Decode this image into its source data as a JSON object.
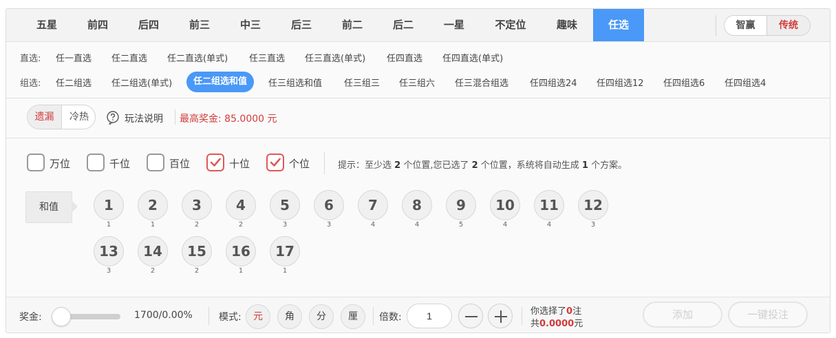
{
  "tabs": [
    "五星",
    "前四",
    "后四",
    "前三",
    "中三",
    "后三",
    "前二",
    "后二",
    "一星",
    "不定位",
    "趣味",
    "任选"
  ],
  "active_tab": "任选",
  "mode_switch": {
    "left": "智赢",
    "right": "传统",
    "active": "传统"
  },
  "subplays": {
    "direct": {
      "label": "直选:",
      "items": [
        "任一直选",
        "任二直选",
        "任二直选(单式)",
        "任三直选",
        "任三直选(单式)",
        "任四直选",
        "任四直选(单式)"
      ]
    },
    "group": {
      "label": "组选:",
      "items": [
        "任二组选",
        "任二组选(单式)",
        "任二组选和值",
        "任三组选和值",
        "任三组三",
        "任三组六",
        "任三混合组选",
        "任四组选24",
        "任四组选12",
        "任四组选6",
        "任四组选4"
      ],
      "active": "任二组选和值"
    }
  },
  "info": {
    "miss_switch": {
      "left": "遗漏",
      "right": "冷热",
      "active": "遗漏"
    },
    "help_label": "玩法说明",
    "max_prize": "最高奖金: 85.0000 元"
  },
  "positions": [
    {
      "label": "万位",
      "checked": false
    },
    {
      "label": "千位",
      "checked": false
    },
    {
      "label": "百位",
      "checked": false
    },
    {
      "label": "十位",
      "checked": true
    },
    {
      "label": "个位",
      "checked": true
    }
  ],
  "hint": {
    "t1": "提示：至少选 ",
    "n1": "2",
    "t2": " 个位置,您已选了 ",
    "n2": "2",
    "t3": " 个位置，系统将自动生成 ",
    "n3": "1",
    "t4": " 个方案。"
  },
  "sum_label": "和值",
  "balls": [
    {
      "num": "1",
      "miss": "1"
    },
    {
      "num": "2",
      "miss": "1"
    },
    {
      "num": "3",
      "miss": "2"
    },
    {
      "num": "4",
      "miss": "2"
    },
    {
      "num": "5",
      "miss": "3"
    },
    {
      "num": "6",
      "miss": "3"
    },
    {
      "num": "7",
      "miss": "4"
    },
    {
      "num": "8",
      "miss": "4"
    },
    {
      "num": "9",
      "miss": "5"
    },
    {
      "num": "10",
      "miss": "4"
    },
    {
      "num": "11",
      "miss": "4"
    },
    {
      "num": "12",
      "miss": "3"
    },
    {
      "num": "13",
      "miss": "3"
    },
    {
      "num": "14",
      "miss": "2"
    },
    {
      "num": "15",
      "miss": "2"
    },
    {
      "num": "16",
      "miss": "1"
    },
    {
      "num": "17",
      "miss": "1"
    }
  ],
  "footer": {
    "prize_label": "奖金:",
    "prize_value": "1700/0.00%",
    "slider_level": 0,
    "mode_label": "模式:",
    "units": [
      "元",
      "角",
      "分",
      "厘"
    ],
    "active_unit": "元",
    "multiple_label": "倍数:",
    "multiple_value": "1",
    "summary": {
      "t1": "你选择了",
      "count": "0",
      "t2": "注",
      "t3": "共",
      "amount": "0.0000",
      "t4": "元"
    },
    "add_label": "添加",
    "quick_bet_label": "一键投注"
  },
  "colors": {
    "accent": "#4a98f7",
    "red": "#d23c3c",
    "check": "#e15858"
  }
}
